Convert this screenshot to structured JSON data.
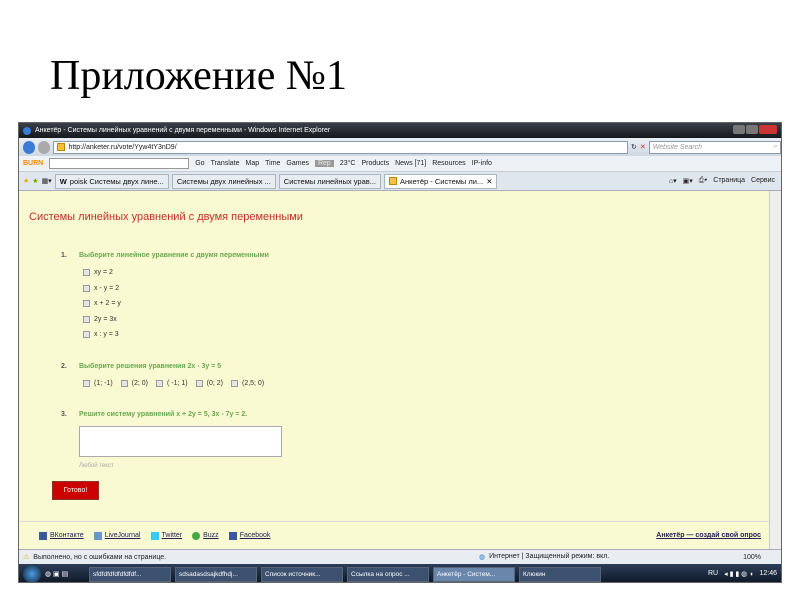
{
  "slide": {
    "title": "Приложение №1"
  },
  "browser": {
    "window_title": "Анкетёр - Системы линейных уравнений с двумя переменными - Windows Internet Explorer",
    "url": "http://anketer.ru/vote/Yyw4tY3nD9/",
    "search_placeholder": "Website Search",
    "toolbar": [
      "Go",
      "Translate",
      "Map",
      "Time",
      "Games",
      "Rep",
      "23°C",
      "Products",
      "News [71]",
      "Resources",
      "IP-info"
    ],
    "tabs": [
      "poisk Системы двух лине...",
      "Системы двух линейных ...",
      "Системы линейных урав...",
      "Анкетёр - Системы ли..."
    ],
    "tab_tools": [
      "Страница",
      "Сервис"
    ],
    "status": "Выполнено, но с ошибками на странице.",
    "zone": "Интернет | Защищенный режим: вкл.",
    "zoom": "100%"
  },
  "page": {
    "heading": "Системы линейных уравнений с двумя переменными",
    "q1": {
      "num": "1.",
      "text": "Выберите линейное уравнение с двумя переменными",
      "options": [
        "xy = 2",
        "x - y = 2",
        "x + 2 = y",
        "2y = 3x",
        "x : y = 3"
      ]
    },
    "q2": {
      "num": "2.",
      "text": "Выберите решения уравнения 2x - 3y = 5",
      "options": [
        "(1; -1)",
        "(2; 0)",
        "( -1; 1)",
        "(0; 2)",
        "(2,5; 0)"
      ]
    },
    "q3": {
      "num": "3.",
      "text": "Решите систему уравнений x + 2y = 5, 3x - 7y = 2.",
      "hint": "Любой текст"
    },
    "submit": "Готово!",
    "share": [
      "ВКонтакте",
      "LiveJournal",
      "Twitter",
      "Buzz",
      "Facebook"
    ],
    "create": "Анкетёр — создай свой опрос"
  },
  "taskbar": {
    "items": [
      "sfdfdfdfdfdfdfdf...",
      "sdsadasdsajkdfhdj...",
      "Список источник...",
      "Ссылка на опрос ...",
      "Анкетёр - Систем...",
      "Клюкин"
    ],
    "lang": "RU",
    "time": "12:46"
  }
}
